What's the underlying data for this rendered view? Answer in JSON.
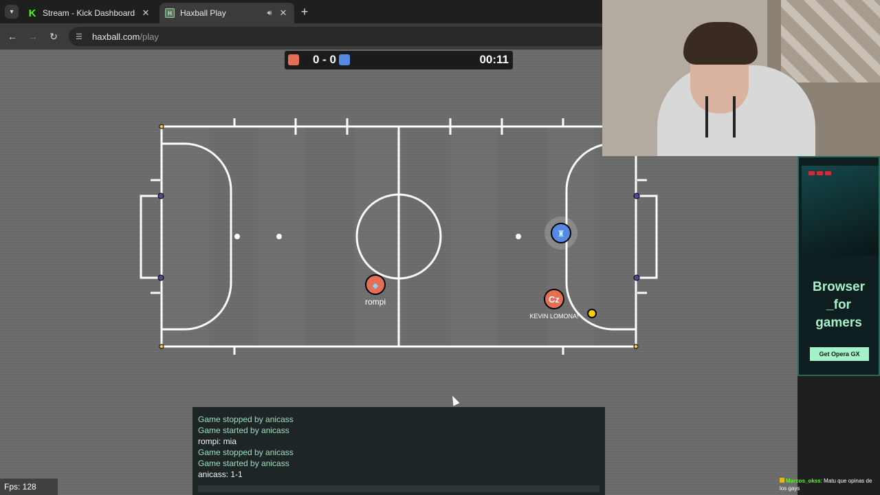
{
  "browser": {
    "tabs": [
      {
        "title": "Stream - Kick Dashboard",
        "favicon": "kick-logo-icon",
        "active": false
      },
      {
        "title": "Haxball Play",
        "favicon": "haxball-icon",
        "active": true
      }
    ],
    "url": {
      "domain": "haxball.com",
      "path": "/play"
    }
  },
  "scoreboard": {
    "score": "0 - 0",
    "time": "00:11",
    "red": "#e56e56",
    "blue": "#5689e5"
  },
  "players": [
    {
      "name": "rompi",
      "team": "red"
    },
    {
      "name": "KEVIN LOMONA!",
      "team": "red",
      "avatar": "Cz"
    },
    {
      "name": "",
      "team": "blue"
    }
  ],
  "chat": [
    {
      "text": "Game stopped by anicass",
      "kind": "sys"
    },
    {
      "text": "Game started by anicass",
      "kind": "sys"
    },
    {
      "text": "rompi: mia",
      "kind": "msg"
    },
    {
      "text": "Game stopped by anicass",
      "kind": "sys"
    },
    {
      "text": "Game started by anicass",
      "kind": "sys"
    },
    {
      "text": "anicass: 1-1",
      "kind": "msg"
    }
  ],
  "fps": "Fps: 128",
  "ad": {
    "headline_1": "Browser",
    "headline_2": "_for",
    "headline_3": "gamers",
    "button": "Get Opera GX"
  },
  "stream_chat": {
    "user": "Marcos_okss",
    "message": ": Matu que opinas de los gays"
  }
}
